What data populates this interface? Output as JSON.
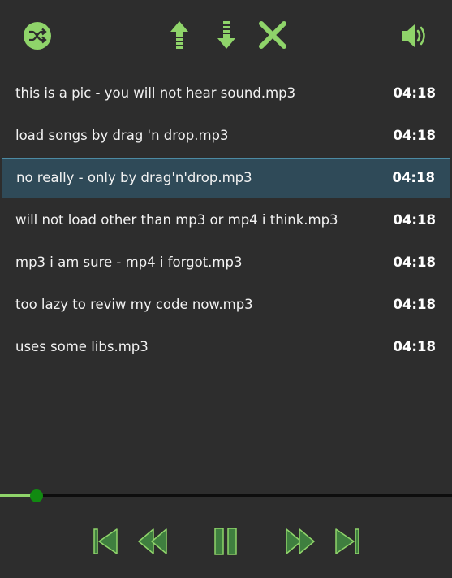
{
  "toolbar": {
    "shuffle_icon": "shuffle-icon",
    "move_up_icon": "arrow-up-icon",
    "move_down_icon": "arrow-down-icon",
    "remove_icon": "close-icon",
    "volume_icon": "speaker-icon"
  },
  "colors": {
    "background": "#2d2d2d",
    "accent_green": "#8fd46a",
    "dark_green": "#3f7f3f",
    "selected_row": "#2f4a58",
    "selected_border": "#4c8aa3",
    "seek_thumb": "#118a11"
  },
  "playlist": {
    "selected_index": 2,
    "tracks": [
      {
        "title": "this is a pic - you will not hear sound.mp3",
        "duration": "04:18"
      },
      {
        "title": "load songs by drag 'n drop.mp3",
        "duration": "04:18"
      },
      {
        "title": "no really - only by drag'n'drop.mp3",
        "duration": "04:18"
      },
      {
        "title": "will not load other than mp3 or mp4 i think.mp3",
        "duration": "04:18"
      },
      {
        "title": "mp3 i am sure - mp4 i forgot.mp3",
        "duration": "04:18"
      },
      {
        "title": "too lazy to reviw my code now.mp3",
        "duration": "04:18"
      },
      {
        "title": "uses some libs.mp3",
        "duration": "04:18"
      }
    ]
  },
  "progress": {
    "fraction": 0.08
  },
  "controls": {
    "first_icon": "skip-to-start-icon",
    "previous_icon": "previous-icon",
    "pause_icon": "pause-icon",
    "next_icon": "next-icon",
    "last_icon": "skip-to-end-icon"
  }
}
